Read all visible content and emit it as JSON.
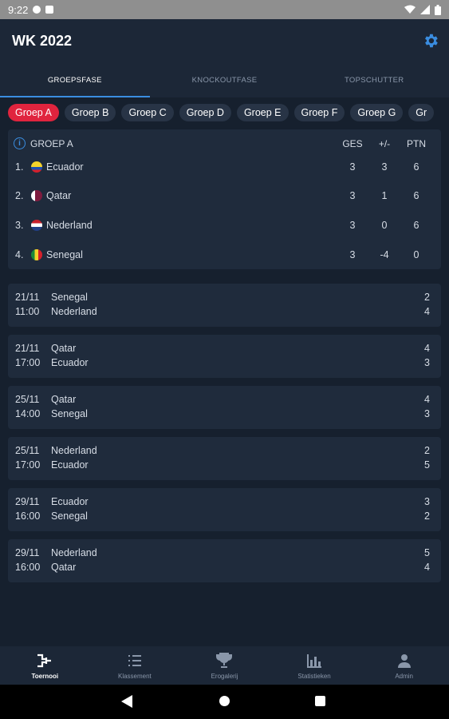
{
  "status_bar": {
    "time": "9:22"
  },
  "app_bar": {
    "title": "WK 2022",
    "settings_icon": "gear-icon"
  },
  "tabs": [
    {
      "label": "GROEPSFASE",
      "active": true
    },
    {
      "label": "KNOCKOUTFASE",
      "active": false
    },
    {
      "label": "TOPSCHUTTER",
      "active": false
    }
  ],
  "group_chips": [
    "Groep A",
    "Groep B",
    "Groep C",
    "Groep D",
    "Groep E",
    "Groep F",
    "Groep G",
    "Gr"
  ],
  "standings": {
    "title": "GROEP A",
    "columns": [
      "GES",
      "+/-",
      "PTN"
    ],
    "rows": [
      {
        "pos": "1.",
        "team": "Ecuador",
        "ges": "3",
        "diff": "3",
        "ptn": "6"
      },
      {
        "pos": "2.",
        "team": "Qatar",
        "ges": "3",
        "diff": "1",
        "ptn": "6"
      },
      {
        "pos": "3.",
        "team": "Nederland",
        "ges": "3",
        "diff": "0",
        "ptn": "6"
      },
      {
        "pos": "4.",
        "team": "Senegal",
        "ges": "3",
        "diff": "-4",
        "ptn": "0"
      }
    ]
  },
  "matches": [
    {
      "date": "21/11",
      "time": "11:00",
      "home": "Senegal",
      "away": "Nederland",
      "home_score": "2",
      "away_score": "4"
    },
    {
      "date": "21/11",
      "time": "17:00",
      "home": "Qatar",
      "away": "Ecuador",
      "home_score": "4",
      "away_score": "3"
    },
    {
      "date": "25/11",
      "time": "14:00",
      "home": "Qatar",
      "away": "Senegal",
      "home_score": "4",
      "away_score": "3"
    },
    {
      "date": "25/11",
      "time": "17:00",
      "home": "Nederland",
      "away": "Ecuador",
      "home_score": "2",
      "away_score": "5"
    },
    {
      "date": "29/11",
      "time": "16:00",
      "home": "Ecuador",
      "away": "Senegal",
      "home_score": "3",
      "away_score": "2"
    },
    {
      "date": "29/11",
      "time": "16:00",
      "home": "Nederland",
      "away": "Qatar",
      "home_score": "5",
      "away_score": "4"
    }
  ],
  "bottom_nav": [
    {
      "label": "Toernooi",
      "icon": "bracket-icon",
      "active": true
    },
    {
      "label": "Klassement",
      "icon": "list-icon",
      "active": false
    },
    {
      "label": "Erogalerij",
      "icon": "trophy-icon",
      "active": false
    },
    {
      "label": "Statistieken",
      "icon": "bar-chart-icon",
      "active": false
    },
    {
      "label": "Admin",
      "icon": "person-icon",
      "active": false
    }
  ],
  "colors": {
    "background": "#16202e",
    "card": "#1f2b3c",
    "accent": "#3a8de0",
    "active_chip": "#e0243e"
  }
}
